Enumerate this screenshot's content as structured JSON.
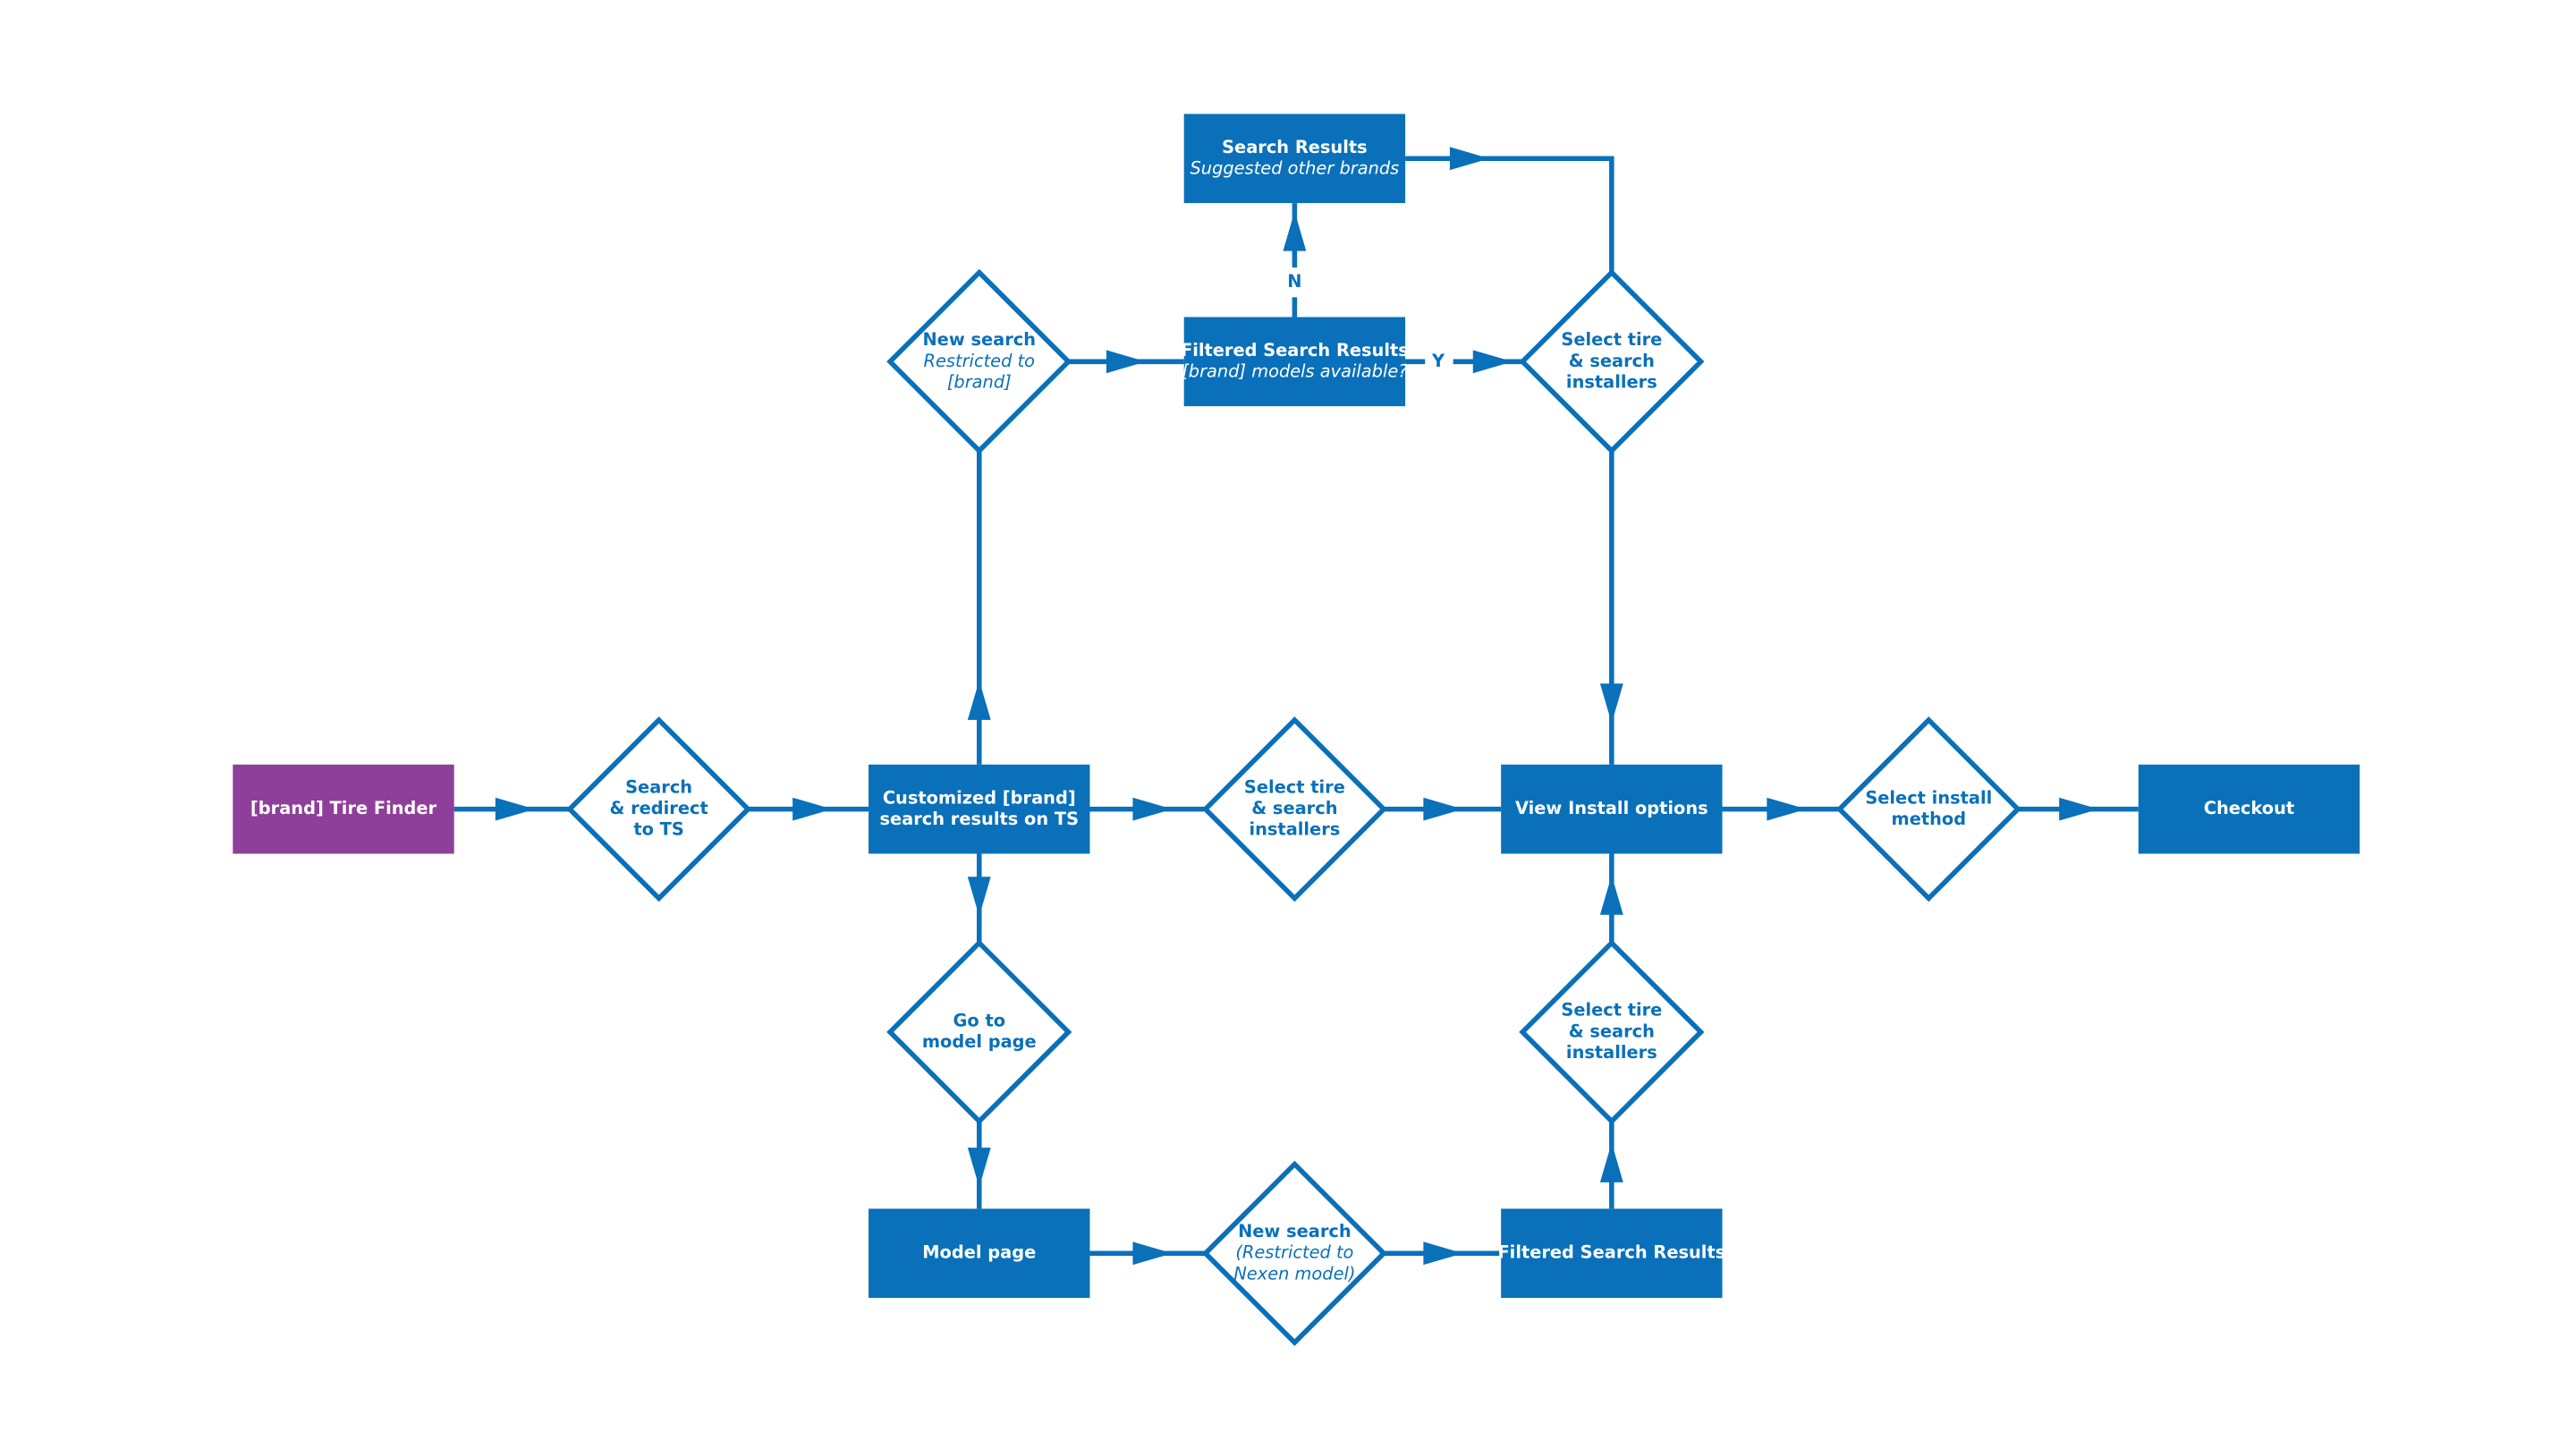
{
  "colors": {
    "primary": "#0A70BA",
    "start": "#8E3F9A",
    "background": "#FFFFFF"
  },
  "nodes": [
    {
      "id": "tire-finder",
      "shape": "rect",
      "lines": [
        {
          "text": "[brand] Tire Finder"
        }
      ]
    },
    {
      "id": "search-redirect",
      "shape": "diamond",
      "lines": [
        {
          "text": "Search"
        },
        {
          "text": "& redirect"
        },
        {
          "text": "to TS"
        }
      ]
    },
    {
      "id": "customized-results",
      "shape": "rect",
      "lines": [
        {
          "text": "Customized [brand]"
        },
        {
          "text": "search results on TS"
        }
      ]
    },
    {
      "id": "new-search-brand",
      "shape": "diamond",
      "lines": [
        {
          "text": "New search"
        },
        {
          "text": "Restricted to",
          "italic": true
        },
        {
          "text": "[brand]",
          "italic": true
        }
      ]
    },
    {
      "id": "filtered-results-top",
      "shape": "rect",
      "lines": [
        {
          "text": "Filtered Search Results"
        },
        {
          "text": "[brand] models available?",
          "italic": true
        }
      ]
    },
    {
      "id": "search-results-other",
      "shape": "rect",
      "lines": [
        {
          "text": "Search Results"
        },
        {
          "text": "Suggested other brands",
          "italic": true
        }
      ]
    },
    {
      "id": "select-tire-top",
      "shape": "diamond",
      "lines": [
        {
          "text": "Select tire"
        },
        {
          "text": "& search"
        },
        {
          "text": "installers"
        }
      ]
    },
    {
      "id": "select-tire-mid",
      "shape": "diamond",
      "lines": [
        {
          "text": "Select tire"
        },
        {
          "text": "& search"
        },
        {
          "text": "installers"
        }
      ]
    },
    {
      "id": "view-install",
      "shape": "rect",
      "lines": [
        {
          "text": "View Install options"
        }
      ]
    },
    {
      "id": "select-install-method",
      "shape": "diamond",
      "lines": [
        {
          "text": "Select install"
        },
        {
          "text": "method"
        }
      ]
    },
    {
      "id": "checkout",
      "shape": "rect",
      "lines": [
        {
          "text": "Checkout"
        }
      ]
    },
    {
      "id": "go-model-page",
      "shape": "diamond",
      "lines": [
        {
          "text": "Go to"
        },
        {
          "text": "model page"
        }
      ]
    },
    {
      "id": "model-page",
      "shape": "rect",
      "lines": [
        {
          "text": "Model page"
        }
      ]
    },
    {
      "id": "new-search-nexen",
      "shape": "diamond",
      "lines": [
        {
          "text": "New search"
        },
        {
          "text": "(Restricted to",
          "italic": true
        },
        {
          "text": "Nexen model)",
          "italic": true
        }
      ]
    },
    {
      "id": "filtered-results-bottom",
      "shape": "rect",
      "lines": [
        {
          "text": "Filtered Search Results"
        }
      ]
    },
    {
      "id": "select-tire-bottom",
      "shape": "diamond",
      "lines": [
        {
          "text": "Select tire"
        },
        {
          "text": "& search"
        },
        {
          "text": "installers"
        }
      ]
    }
  ],
  "edges": [
    {
      "from": "tire-finder",
      "to": "search-redirect"
    },
    {
      "from": "search-redirect",
      "to": "customized-results"
    },
    {
      "from": "customized-results",
      "to": "select-tire-mid"
    },
    {
      "from": "select-tire-mid",
      "to": "view-install"
    },
    {
      "from": "view-install",
      "to": "select-install-method"
    },
    {
      "from": "select-install-method",
      "to": "checkout"
    },
    {
      "from": "customized-results",
      "to": "new-search-brand"
    },
    {
      "from": "new-search-brand",
      "to": "filtered-results-top"
    },
    {
      "from": "filtered-results-top",
      "to": "search-results-other",
      "label": "N"
    },
    {
      "from": "filtered-results-top",
      "to": "select-tire-top",
      "label": "Y"
    },
    {
      "from": "search-results-other",
      "to": "select-tire-top"
    },
    {
      "from": "select-tire-top",
      "to": "view-install"
    },
    {
      "from": "customized-results",
      "to": "go-model-page"
    },
    {
      "from": "go-model-page",
      "to": "model-page"
    },
    {
      "from": "model-page",
      "to": "new-search-nexen"
    },
    {
      "from": "new-search-nexen",
      "to": "filtered-results-bottom"
    },
    {
      "from": "filtered-results-bottom",
      "to": "select-tire-bottom"
    },
    {
      "from": "select-tire-bottom",
      "to": "view-install"
    }
  ]
}
